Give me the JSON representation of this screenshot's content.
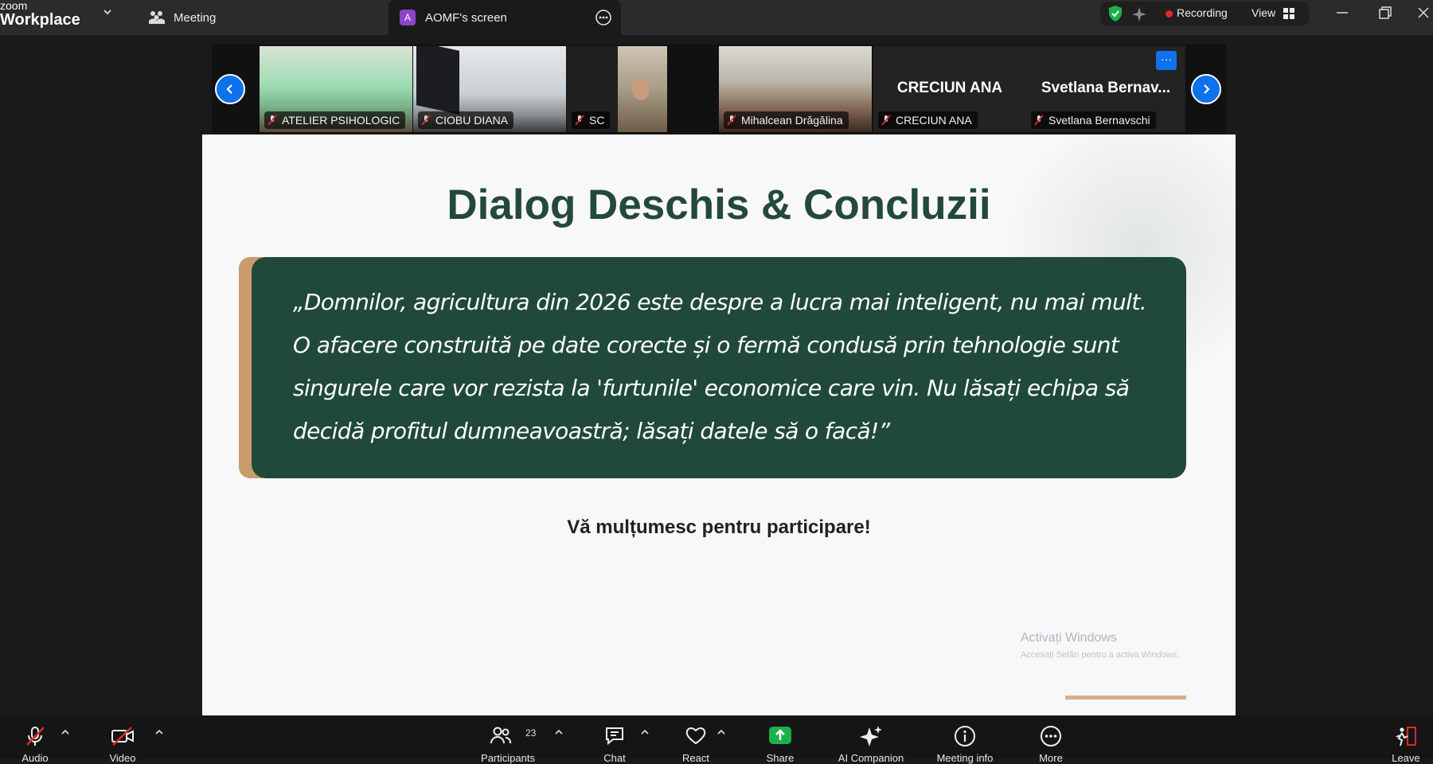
{
  "app": {
    "logo_top": "zoom",
    "logo_bottom": "Workplace"
  },
  "tabs": {
    "meeting": "Meeting",
    "screen": "AOMF's screen",
    "screen_avatar": "A"
  },
  "status": {
    "recording": "Recording",
    "view": "View"
  },
  "participants": [
    {
      "name": "ATELIER PSIHOLOGIC"
    },
    {
      "name": "CIOBU DIANA"
    },
    {
      "name": "SC"
    },
    {
      "name": "Mihalcean Drăgălina"
    },
    {
      "name": "CRECIUN ANA",
      "display": "CRECIUN ANA"
    },
    {
      "name": "Svetlana Bernavschi",
      "display": "Svetlana  Bernav..."
    }
  ],
  "tile_more": "···",
  "slide": {
    "title": "Dialog Deschis & Concluzii",
    "quote": "„Domnilor, agricultura din 2026 este despre a lucra mai inteligent, nu mai mult. O afacere construită pe date corecte și o fermă condusă prin tehnologie sunt singurele care vor rezista la 'furtunile' economice care vin. Nu lăsați echipa să decidă profitul dumneavoastră; lăsați datele să o facă!”",
    "thanks": "Vă mulțumesc pentru participare!",
    "watermark_title": "Activați Windows",
    "watermark_sub": "Accesați Setări pentru a activa Windows."
  },
  "toolbar": {
    "audio": "Audio",
    "video": "Video",
    "participants": "Participants",
    "participants_count": "23",
    "chat": "Chat",
    "react": "React",
    "share": "Share",
    "ai": "AI Companion",
    "info": "Meeting info",
    "more": "More",
    "leave": "Leave"
  },
  "colors": {
    "accent_blue": "#0e72ed",
    "slide_green": "#20493a",
    "accent_tan": "#c99c6c",
    "share_green": "#1bb14a",
    "record_red": "#e02828"
  }
}
